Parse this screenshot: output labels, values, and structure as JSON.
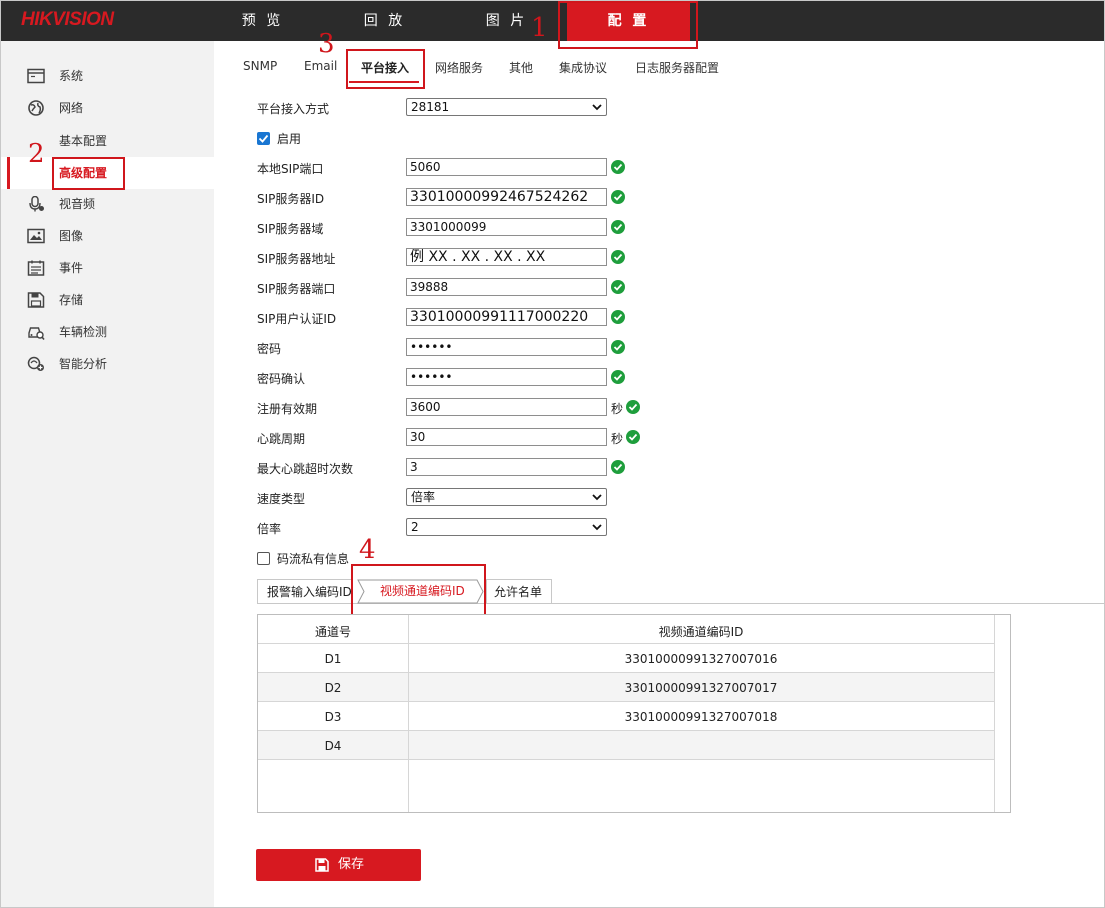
{
  "brand": {
    "logo_text": "HIKVISION",
    "accent_color": "#d71920"
  },
  "top_nav": {
    "items": [
      {
        "label": "预 览"
      },
      {
        "label": "回 放"
      },
      {
        "label": "图 片"
      },
      {
        "label": "配 置",
        "active": true
      }
    ]
  },
  "annotations": {
    "n1": "1",
    "n2": "2",
    "n3": "3",
    "n4": "4"
  },
  "sidebar": {
    "items": [
      {
        "label": "系统",
        "icon": "monitor-icon"
      },
      {
        "label": "网络",
        "icon": "globe-icon"
      },
      {
        "label": "基本配置"
      },
      {
        "label": "高级配置",
        "active": true
      },
      {
        "label": "视音频",
        "icon": "microphone-icon"
      },
      {
        "label": "图像",
        "icon": "image-icon"
      },
      {
        "label": "事件",
        "icon": "calendar-icon"
      },
      {
        "label": "存储",
        "icon": "floppy-icon"
      },
      {
        "label": "车辆检测",
        "icon": "vehicle-search-icon"
      },
      {
        "label": "智能分析",
        "icon": "smart-analysis-icon"
      }
    ]
  },
  "tabs": [
    {
      "label": "SNMP"
    },
    {
      "label": "Email"
    },
    {
      "label": "平台接入",
      "active": true
    },
    {
      "label": "网络服务"
    },
    {
      "label": "其他"
    },
    {
      "label": "集成协议"
    },
    {
      "label": "日志服务器配置"
    }
  ],
  "form": {
    "access_mode": {
      "label": "平台接入方式",
      "value": "28181"
    },
    "enable": {
      "label": "启用",
      "checked": true
    },
    "local_sip_port": {
      "label": "本地SIP端口",
      "value": "5060"
    },
    "sip_server_id": {
      "label": "SIP服务器ID",
      "value": "33010000992467524262"
    },
    "sip_server_domain": {
      "label": "SIP服务器域",
      "value": "3301000099"
    },
    "sip_server_address": {
      "label": "SIP服务器地址",
      "value": "例 XX . XX . XX . XX"
    },
    "sip_server_port": {
      "label": "SIP服务器端口",
      "value": "39888"
    },
    "sip_user_auth_id": {
      "label": "SIP用户认证ID",
      "value": "33010000991117000220"
    },
    "password": {
      "label": "密码",
      "value": "••••••"
    },
    "password_confirm": {
      "label": "密码确认",
      "value": "••••••"
    },
    "register_expiry": {
      "label": "注册有效期",
      "value": "3600",
      "unit": "秒"
    },
    "heartbeat_period": {
      "label": "心跳周期",
      "value": "30",
      "unit": "秒"
    },
    "max_heartbeat_timeouts": {
      "label": "最大心跳超时次数",
      "value": "3"
    },
    "speed_type": {
      "label": "速度类型",
      "value": "倍率"
    },
    "rate": {
      "label": "倍率",
      "value": "2"
    },
    "stream_private_info": {
      "label": "码流私有信息",
      "checked": false
    }
  },
  "subtabs": [
    {
      "label": "报警输入编码ID"
    },
    {
      "label": "视频通道编码ID",
      "active": true
    },
    {
      "label": "允许名单"
    }
  ],
  "channel_table": {
    "headers": [
      "通道号",
      "视频通道编码ID"
    ],
    "rows": [
      {
        "channel": "D1",
        "code": "33010000991327007016"
      },
      {
        "channel": "D2",
        "code": "33010000991327007017"
      },
      {
        "channel": "D3",
        "code": "33010000991327007018"
      },
      {
        "channel": "D4",
        "code": ""
      }
    ]
  },
  "save_button": {
    "label": "保存"
  },
  "colors": {
    "check_green": "#1e9e3c",
    "checkbox_blue": "#1976d2",
    "topbar": "#2b2b2b"
  }
}
